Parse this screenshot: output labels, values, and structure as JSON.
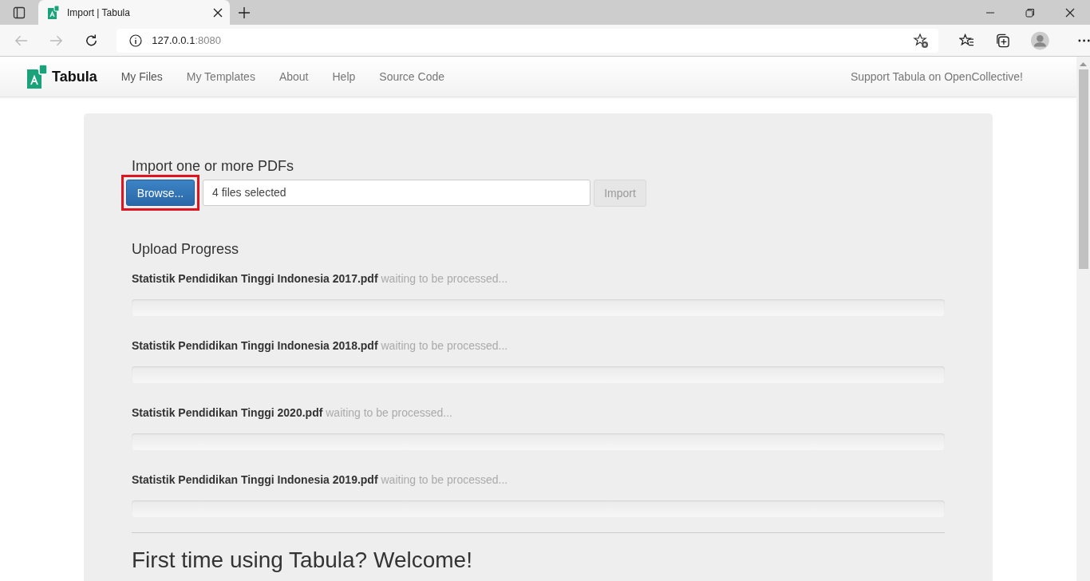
{
  "browser": {
    "tab_title": "Import | Tabula",
    "url_host": "127.0.0.1",
    "url_port": ":8080"
  },
  "navbar": {
    "brand": "Tabula",
    "links": [
      {
        "label": "My Files",
        "selected": true
      },
      {
        "label": "My Templates",
        "selected": false
      },
      {
        "label": "About",
        "selected": false
      },
      {
        "label": "Help",
        "selected": false
      },
      {
        "label": "Source Code",
        "selected": false
      }
    ],
    "support_link": "Support Tabula on OpenCollective!"
  },
  "import": {
    "heading": "Import one or more PDFs",
    "browse_button": "Browse...",
    "browse_highlighted": true,
    "file_field": "4 files selected",
    "import_button": "Import",
    "import_disabled": true
  },
  "upload": {
    "heading": "Upload Progress",
    "files": [
      {
        "name": "Statistik Pendidikan Tinggi Indonesia 2017.pdf",
        "status": "waiting to be processed...",
        "level": 0
      },
      {
        "name": "Statistik Pendidikan Tinggi Indonesia 2018.pdf",
        "status": "waiting to be processed...",
        "level": 0
      },
      {
        "name": "Statistik Pendidikan Tinggi 2020.pdf",
        "status": "waiting to be processed...",
        "level": 0
      },
      {
        "name": "Statistik Pendidikan Tinggi Indonesia 2019.pdf",
        "status": "waiting to be processed...",
        "level": 0
      }
    ]
  },
  "welcome": {
    "heading": "First time using Tabula? Welcome!"
  }
}
